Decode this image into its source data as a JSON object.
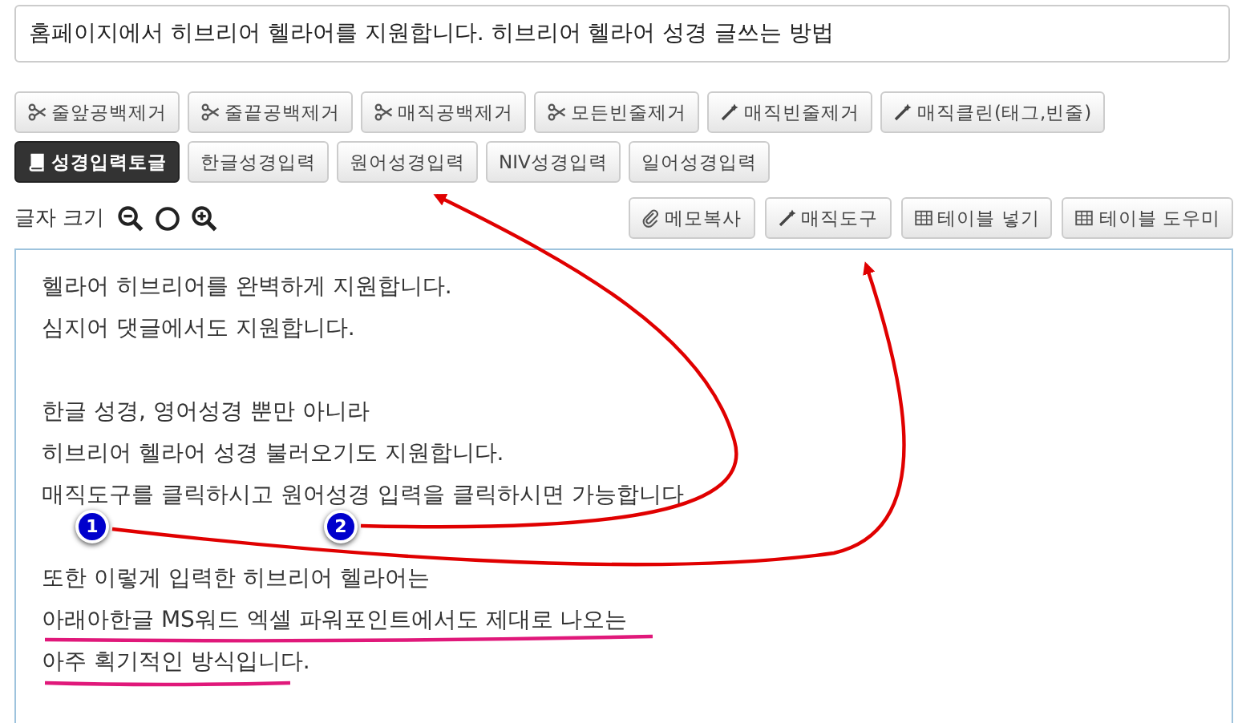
{
  "title_field": {
    "value": "홈페이지에서 히브리어 헬라어를 지원합니다.  히브리어 헬라어 성경 글쓰는 방법"
  },
  "cleanup_buttons": [
    {
      "label": "줄앞공백제거",
      "kind": "remove"
    },
    {
      "label": "줄끝공백제거",
      "kind": "remove"
    },
    {
      "label": "매직공백제거",
      "kind": "remove"
    },
    {
      "label": "모든빈줄제거",
      "kind": "remove"
    },
    {
      "label": "매직빈줄제거",
      "kind": "magic"
    },
    {
      "label": "매직클린(태그,빈줄)",
      "kind": "magic"
    }
  ],
  "bible_buttons": [
    {
      "label": "성경입력토글",
      "kind": "toggle",
      "on": true
    },
    {
      "label": "한글성경입력",
      "kind": "input",
      "on": false
    },
    {
      "label": "원어성경입력",
      "kind": "input",
      "on": false
    },
    {
      "label": "NIV성경입력",
      "kind": "input",
      "on": false
    },
    {
      "label": "일어성경입력",
      "kind": "input",
      "on": false
    }
  ],
  "font_size": {
    "label": "글자 크기"
  },
  "tool_buttons": [
    {
      "label": "메모복사",
      "kind": "copy"
    },
    {
      "label": "매직도구",
      "kind": "magic"
    },
    {
      "label": "테이블 넣기",
      "kind": "table"
    },
    {
      "label": "테이블 도우미",
      "kind": "table"
    }
  ],
  "editor_paragraphs": [
    [
      "헬라어 히브리어를 완벽하게 지원합니다.",
      "심지어 댓글에서도 지원합니다."
    ],
    [
      "한글 성경, 영어성경 뿐만 아니라",
      "히브리어 헬라어 성경 불러오기도 지원합니다.",
      "매직도구를 클릭하시고 원어성경 입력을 클릭하시면 가능합니다"
    ],
    [
      "또한 이렇게 입력한 히브리어 헬라어는",
      "아래아한글 MS워드 엑셀 파워포인트에서도 제대로 나오는",
      "아주 획기적인 방식입니다."
    ]
  ],
  "annotations": {
    "badges": [
      "1",
      "2"
    ]
  }
}
